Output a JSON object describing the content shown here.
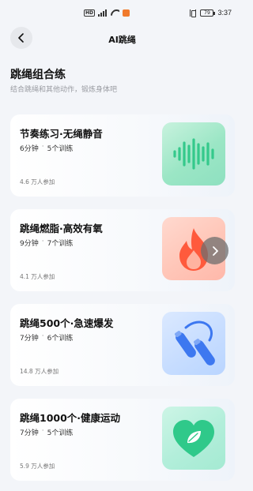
{
  "status_bar": {
    "hd_label": "HD",
    "battery": "79",
    "time": "3:37"
  },
  "header": {
    "title": "AI跳绳"
  },
  "section": {
    "title": "跳绳组合练",
    "subtitle": "结合跳绳和其他动作，锻炼身体吧"
  },
  "cards": [
    {
      "title": "节奏练习·无绳静音",
      "duration": "6分钟",
      "separator": "·",
      "count": "5个训练",
      "participants": "4.6 万人参加",
      "icon": "sound-wave-icon",
      "color": "#3fd596"
    },
    {
      "title": "跳绳燃脂·高效有氧",
      "duration": "9分钟",
      "separator": "·",
      "count": "7个训练",
      "participants": "4.1 万人参加",
      "icon": "flame-icon",
      "color": "#ff5a3c"
    },
    {
      "title": "跳绳500个·急速爆发",
      "duration": "7分钟",
      "separator": "·",
      "count": "6个训练",
      "participants": "14.8 万人参加",
      "icon": "jump-rope-icon",
      "color": "#3d78f0"
    },
    {
      "title": "跳绳1000个·健康运动",
      "duration": "7分钟",
      "separator": "·",
      "count": "5个训练",
      "participants": "5.9 万人参加",
      "icon": "heart-leaf-icon",
      "color": "#2fc98a"
    }
  ]
}
